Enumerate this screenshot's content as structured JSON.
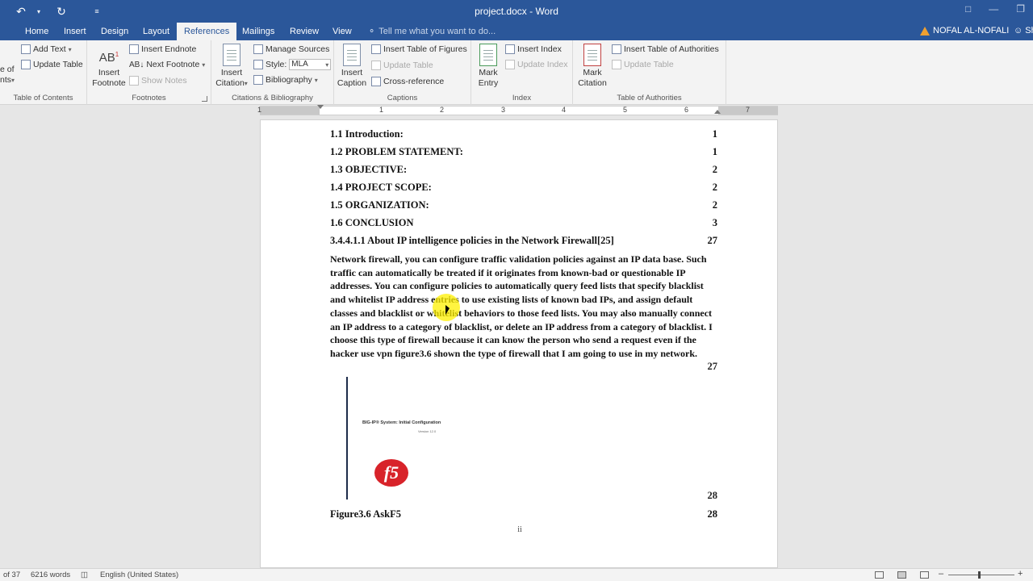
{
  "window": {
    "title": "project.docx - Word"
  },
  "quick_access": {
    "undo_icon": "undo-icon",
    "redo_icon": "redo-icon",
    "customize_icon": "customize-icon"
  },
  "tabs": [
    {
      "label": "Home"
    },
    {
      "label": "Insert"
    },
    {
      "label": "Design"
    },
    {
      "label": "Layout"
    },
    {
      "label": "References",
      "active": true
    },
    {
      "label": "Mailings"
    },
    {
      "label": "Review"
    },
    {
      "label": "View"
    }
  ],
  "tell_me": {
    "placeholder": "Tell me what you want to do..."
  },
  "user": {
    "name": "NOFAL AL-NOFALI",
    "share_label": "Sh"
  },
  "ribbon": {
    "toc": {
      "label": "Table of Contents",
      "toc_button_line1": "e of",
      "toc_button_line2": "nts",
      "add_text": "Add Text",
      "update_table": "Update Table"
    },
    "footnotes": {
      "label": "Footnotes",
      "insert_footnote_line1": "Insert",
      "insert_footnote_line2": "Footnote",
      "insert_endnote": "Insert Endnote",
      "next_footnote": "Next Footnote",
      "show_notes": "Show Notes"
    },
    "citations": {
      "label": "Citations & Bibliography",
      "insert_citation_line1": "Insert",
      "insert_citation_line2": "Citation",
      "manage_sources": "Manage Sources",
      "style_label": "Style:",
      "style_value": "MLA",
      "bibliography": "Bibliography"
    },
    "captions": {
      "label": "Captions",
      "insert_caption_line1": "Insert",
      "insert_caption_line2": "Caption",
      "insert_table_of_figures": "Insert Table of Figures",
      "update_table": "Update Table",
      "cross_reference": "Cross-reference"
    },
    "index": {
      "label": "Index",
      "mark_entry_line1": "Mark",
      "mark_entry_line2": "Entry",
      "insert_index": "Insert Index",
      "update_index": "Update Index"
    },
    "authorities": {
      "label": "Table of Authorities",
      "mark_citation_line1": "Mark",
      "mark_citation_line2": "Citation",
      "insert_table_of_authorities": "Insert Table of Authorities",
      "update_table": "Update Table"
    }
  },
  "ruler": {
    "numbers": [
      "1",
      "1",
      "2",
      "3",
      "4",
      "5",
      "6",
      "7"
    ]
  },
  "document": {
    "toc_lines": [
      {
        "text": "1.1 Introduction:",
        "page": "1"
      },
      {
        "text": "1.2 PROBLEM STATEMENT:",
        "page": "1"
      },
      {
        "text": "1.3 OBJECTIVE:",
        "page": "2"
      },
      {
        "text": "1.4 PROJECT SCOPE:",
        "page": "2"
      },
      {
        "text": "1.5 ORGANIZATION:",
        "page": "2"
      },
      {
        "text": "1.6 CONCLUSION",
        "page": "3"
      },
      {
        "text": "3.4.4.1.1 About IP intelligence policies in the Network Firewall[25]",
        "page": "27"
      }
    ],
    "paragraph": "Network firewall, you can configure traffic validation policies against an IP data base. Such traffic can automatically be treated if it originates from known-bad or questionable IP addresses. You can configure policies to automatically query feed lists that specify blacklist and whitelist IP address entries to use existing lists of known bad IPs, and assign default classes and blacklist or whitelist behaviors to those feed lists. You may also manually connect an IP address to a category of blacklist, or delete an IP address from a category of blacklist. I choose this type of firewall because it can know the person who send a request even if the hacker use vpn figure3.6 shown the type of firewall that I am going to use in my network.",
    "paragraph_page": "27",
    "figure": {
      "title": "BIG-IP® System: Initial Configuration",
      "subtitle": "Version 12.0",
      "logo_text": "f5",
      "page": "28"
    },
    "caption_line": {
      "text": "Figure3.6 AskF5",
      "page": "28"
    },
    "footer": "ii"
  },
  "status": {
    "page_info": "of 37",
    "words": "6216 words",
    "language": "English (United States)"
  },
  "colors": {
    "title_bar": "#2b579a",
    "ribbon_bg": "#f3f3f3",
    "highlight": "#fff000"
  }
}
